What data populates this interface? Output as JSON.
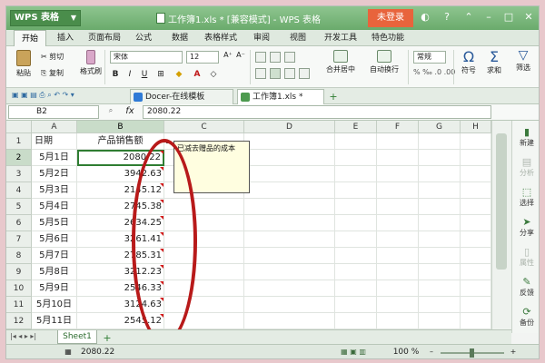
{
  "app": {
    "logo": "WPS 表格",
    "window_title": "工作簿1.xls * [兼容模式] - WPS 表格",
    "login_button": "未登录"
  },
  "menu": {
    "tabs": [
      "开始",
      "插入",
      "页面布局",
      "公式",
      "数据",
      "表格样式",
      "审阅",
      "视图",
      "开发工具",
      "特色功能"
    ]
  },
  "ribbon": {
    "paste": "粘贴",
    "cut": "剪切",
    "copy": "复制",
    "format_painter": "格式刷",
    "font_name": "宋体",
    "font_size": "12",
    "merge_center": "合并居中",
    "wrap_text": "自动换行",
    "number_format": "常规",
    "symbol": "符号",
    "sum": "求和",
    "filter": "筛选"
  },
  "doc_tabs": [
    "Docer-在线模板",
    "工作簿1.xls *"
  ],
  "formula_bar": {
    "cell_ref": "B2",
    "fx": "fx",
    "value": "2080.22"
  },
  "columns": [
    "A",
    "B",
    "C",
    "D",
    "E",
    "F",
    "G",
    "H"
  ],
  "rows": [
    {
      "num": "1",
      "a": "日期",
      "b": "产品销售额"
    },
    {
      "num": "2",
      "a": "5月1日",
      "b": "2080.22"
    },
    {
      "num": "3",
      "a": "5月2日",
      "b": "3942.63"
    },
    {
      "num": "4",
      "a": "5月3日",
      "b": "2145.12"
    },
    {
      "num": "5",
      "a": "5月4日",
      "b": "2745.38"
    },
    {
      "num": "6",
      "a": "5月5日",
      "b": "2634.25"
    },
    {
      "num": "7",
      "a": "5月6日",
      "b": "3261.41"
    },
    {
      "num": "8",
      "a": "5月7日",
      "b": "2785.31"
    },
    {
      "num": "9",
      "a": "5月8日",
      "b": "3212.23"
    },
    {
      "num": "10",
      "a": "5月9日",
      "b": "2546.33"
    },
    {
      "num": "11",
      "a": "5月10日",
      "b": "3124.63"
    },
    {
      "num": "12",
      "a": "5月11日",
      "b": "2545.12"
    }
  ],
  "comment_text": "已减去赠品的成本",
  "right_sidebar": [
    {
      "label": "新建",
      "dim": false
    },
    {
      "label": "分析",
      "dim": true
    },
    {
      "label": "选择",
      "dim": false
    },
    {
      "label": "分享",
      "dim": false
    },
    {
      "label": "属性",
      "dim": true
    },
    {
      "label": "反馈",
      "dim": false
    },
    {
      "label": "备份",
      "dim": false
    }
  ],
  "sheet_tab": "Sheet1",
  "status": {
    "value": "2080.22",
    "zoom": "100 %"
  },
  "colors": {
    "titlebar": "#6aab6c",
    "login": "#e8643c",
    "oval": "#b81a1a",
    "comment_bg": "#fffee0"
  }
}
